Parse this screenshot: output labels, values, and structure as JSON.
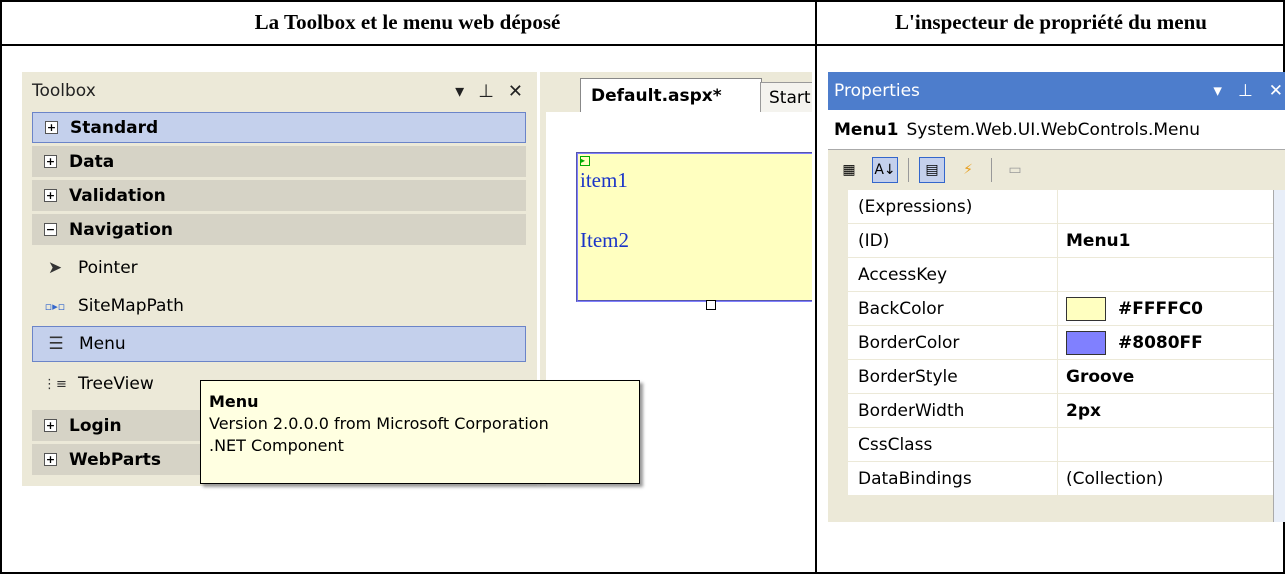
{
  "headers": {
    "left": "La Toolbox et le menu web déposé",
    "right": "L'inspecteur de propriété du menu"
  },
  "toolbox": {
    "title": "Toolbox",
    "categories": [
      {
        "label": "Standard",
        "symbol": "+"
      },
      {
        "label": "Data",
        "symbol": "+"
      },
      {
        "label": "Validation",
        "symbol": "+"
      },
      {
        "label": "Navigation",
        "symbol": "−"
      },
      {
        "label": "Login",
        "symbol": "+"
      },
      {
        "label": "WebParts",
        "symbol": "+"
      }
    ],
    "tools": [
      {
        "label": "Pointer",
        "icon": "pointer-icon"
      },
      {
        "label": "SiteMapPath",
        "icon": "sitemappath-icon"
      },
      {
        "label": "Menu",
        "icon": "menu-icon"
      },
      {
        "label": "TreeView",
        "icon": "treeview-icon"
      }
    ],
    "tooltip": {
      "name": "Menu",
      "version": "Version 2.0.0.0 from Microsoft Corporation",
      "kind": ".NET Component"
    }
  },
  "designer": {
    "active_tab": "Default.aspx*",
    "other_tab": "Start",
    "menu_items": [
      "item1",
      "Item2"
    ]
  },
  "properties": {
    "title": "Properties",
    "object_name": "Menu1",
    "object_type": "System.Web.UI.WebControls.Menu",
    "rows": [
      {
        "name": "(Expressions)",
        "value": ""
      },
      {
        "name": "(ID)",
        "value": "Menu1"
      },
      {
        "name": "AccessKey",
        "value": ""
      },
      {
        "name": "BackColor",
        "value": "#FFFFC0",
        "swatch": "#ffffc0"
      },
      {
        "name": "BorderColor",
        "value": "#8080FF",
        "swatch": "#8080ff"
      },
      {
        "name": "BorderStyle",
        "value": "Groove"
      },
      {
        "name": "BorderWidth",
        "value": "2px"
      },
      {
        "name": "CssClass",
        "value": ""
      },
      {
        "name": "DataBindings",
        "value": "(Collection)"
      }
    ]
  }
}
